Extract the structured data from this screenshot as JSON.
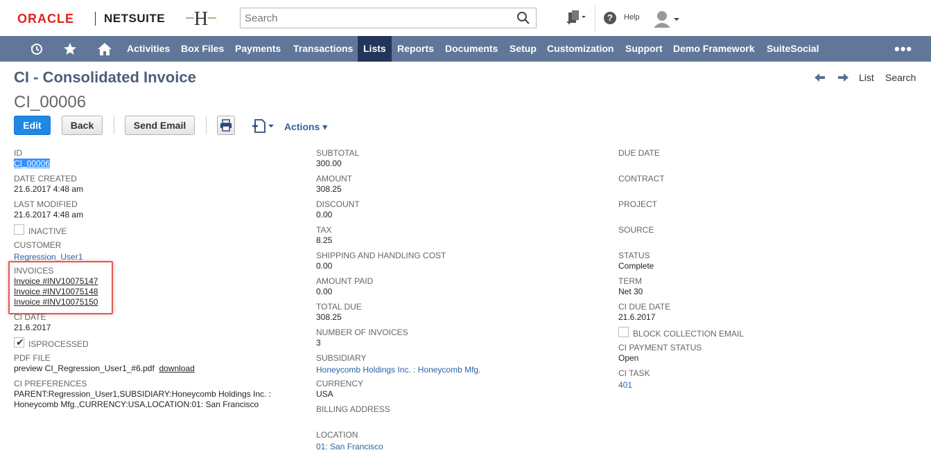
{
  "header": {
    "oracle_logo": "ORACLE",
    "netsuite_logo": "NETSUITE",
    "search_placeholder": "Search",
    "help_label": "Help"
  },
  "nav": {
    "items": [
      "Activities",
      "Box Files",
      "Payments",
      "Transactions",
      "Lists",
      "Reports",
      "Documents",
      "Setup",
      "Customization",
      "Support",
      "Demo Framework",
      "SuiteSocial"
    ],
    "active": "Lists",
    "more": "•••"
  },
  "page": {
    "title": "CI - Consolidated Invoice",
    "record_id": "CI_00006",
    "nav_list": "List",
    "nav_search": "Search"
  },
  "buttons": {
    "edit": "Edit",
    "back": "Back",
    "send_email": "Send Email",
    "actions": "Actions ▾"
  },
  "col1": {
    "id_label": "ID",
    "id_value": "CI_00006",
    "date_created_label": "DATE CREATED",
    "date_created_value": "21.6.2017 4:48 am",
    "last_modified_label": "LAST MODIFIED",
    "last_modified_value": "21.6.2017 4:48 am",
    "inactive_label": "INACTIVE",
    "customer_label": "CUSTOMER",
    "customer_value": "Regression_User1",
    "invoices_label": "INVOICES",
    "invoices": [
      "Invoice #INV10075147",
      "Invoice #INV10075148",
      "Invoice #INV10075150"
    ],
    "ci_date_label": "CI DATE",
    "ci_date_value": "21.6.2017",
    "isprocessed_label": "ISPROCESSED",
    "pdf_file_label": "PDF FILE",
    "pdf_file_value": "preview CI_Regression_User1_#6.pdf",
    "pdf_download": "download",
    "ci_preferences_label": "CI PREFERENCES",
    "ci_preferences_line1": "PARENT:Regression_User1,SUBSIDIARY:Honeycomb Holdings Inc. :",
    "ci_preferences_line2": "Honeycomb Mfg.,CURRENCY:USA,LOCATION:01: San Francisco"
  },
  "col2": {
    "subtotal_label": "SUBTOTAL",
    "subtotal_value": "300.00",
    "amount_label": "AMOUNT",
    "amount_value": "308.25",
    "discount_label": "DISCOUNT",
    "discount_value": "0.00",
    "tax_label": "TAX",
    "tax_value": "8.25",
    "shipping_label": "SHIPPING AND HANDLING COST",
    "shipping_value": "0.00",
    "amount_paid_label": "AMOUNT PAID",
    "amount_paid_value": "0.00",
    "total_due_label": "TOTAL DUE",
    "total_due_value": "308.25",
    "num_invoices_label": "NUMBER OF INVOICES",
    "num_invoices_value": "3",
    "subsidiary_label": "SUBSIDIARY",
    "subsidiary_value": "Honeycomb Holdings Inc. : Honeycomb Mfg.",
    "currency_label": "CURRENCY",
    "currency_value": "USA",
    "billing_address_label": "BILLING ADDRESS",
    "location_label": "LOCATION",
    "location_value": "01: San Francisco"
  },
  "col3": {
    "due_date_label": "DUE DATE",
    "contract_label": "CONTRACT",
    "project_label": "PROJECT",
    "source_label": "SOURCE",
    "status_label": "STATUS",
    "status_value": "Complete",
    "term_label": "TERM",
    "term_value": "Net 30",
    "ci_due_date_label": "CI DUE DATE",
    "ci_due_date_value": "21.6.2017",
    "block_collection_label": "BLOCK COLLECTION EMAIL",
    "ci_payment_status_label": "CI PAYMENT STATUS",
    "ci_payment_status_value": "Open",
    "ci_task_label": "CI TASK",
    "ci_task_value": "401"
  },
  "colors": {
    "nav_bg": "#607799",
    "nav_active": "#23355a",
    "title": "#4d5f79",
    "link": "#2a62a6",
    "primary_button": "#1e88e5",
    "highlight_box": "#e15a52"
  }
}
